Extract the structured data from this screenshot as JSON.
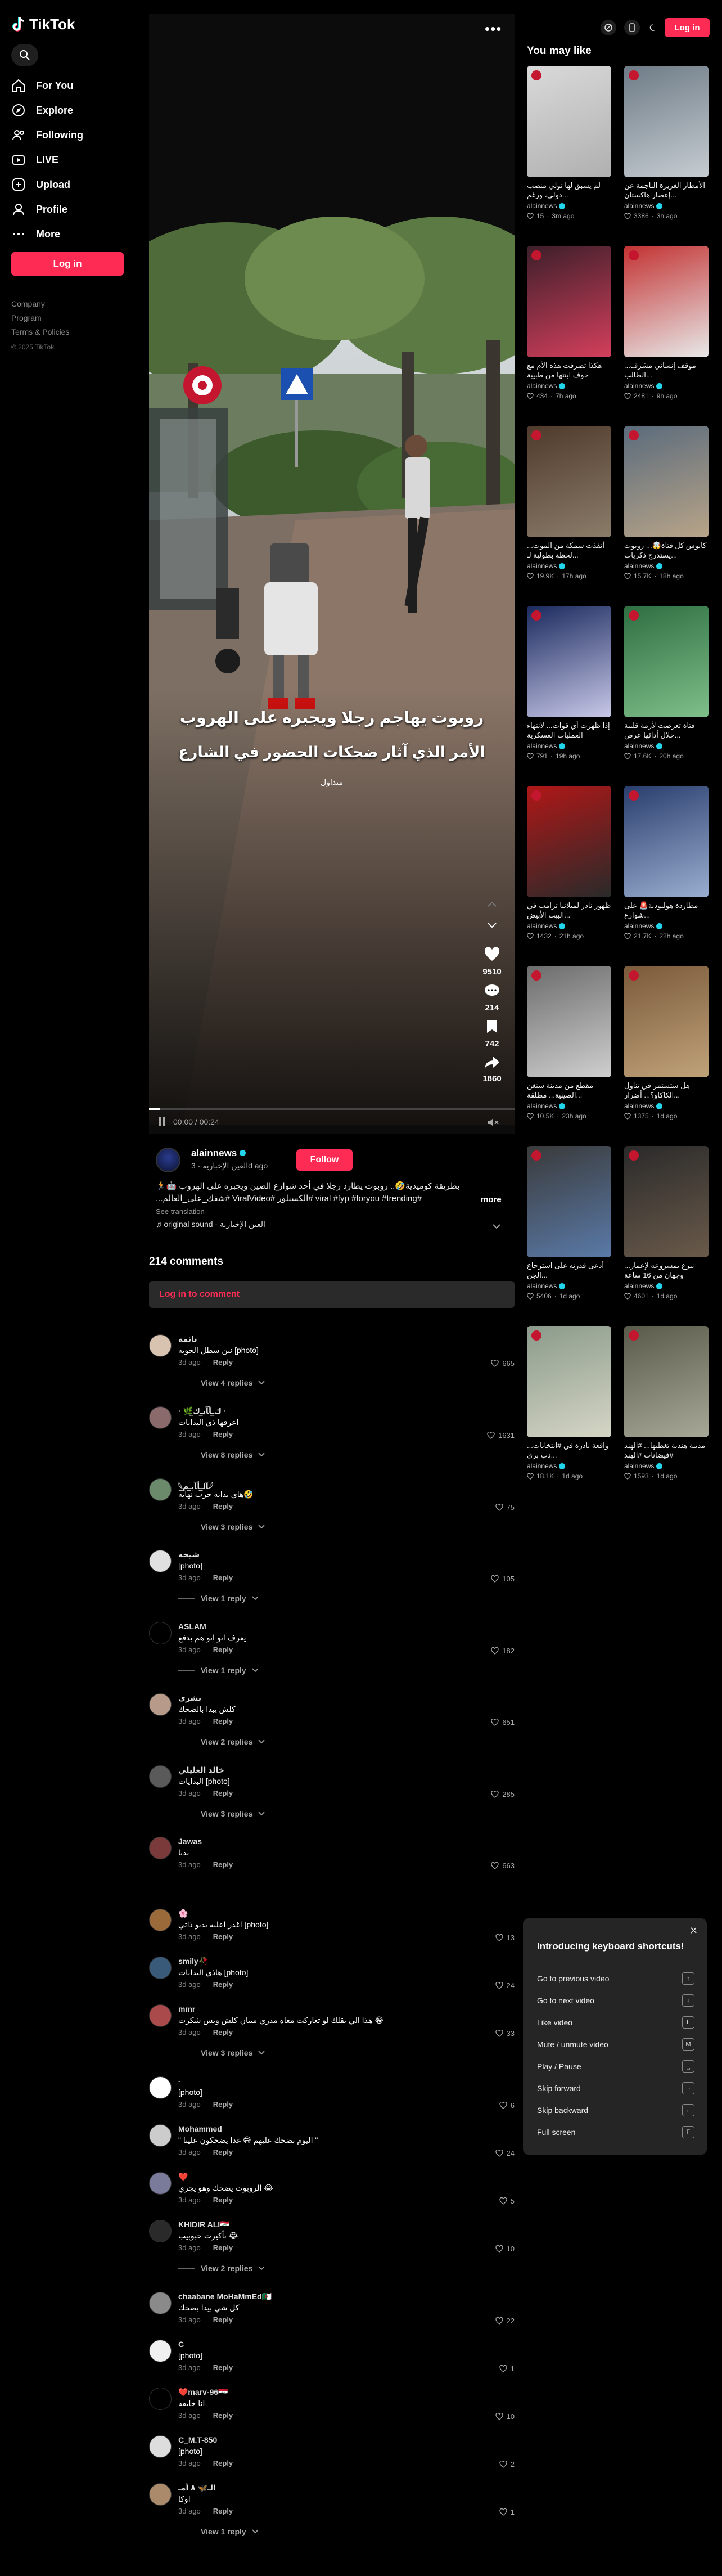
{
  "sidebar": {
    "logo": "TikTok",
    "nav": [
      {
        "label": "For You",
        "icon": "home-icon"
      },
      {
        "label": "Explore",
        "icon": "compass-icon"
      },
      {
        "label": "Following",
        "icon": "following-icon"
      },
      {
        "label": "LIVE",
        "icon": "live-icon"
      },
      {
        "label": "Upload",
        "icon": "upload-icon"
      },
      {
        "label": "Profile",
        "icon": "profile-icon"
      },
      {
        "label": "More",
        "icon": "more-icon"
      }
    ],
    "login_label": "Log in",
    "footer": [
      "Company",
      "Program",
      "Terms & Policies"
    ],
    "copyright": "© 2025 TikTok"
  },
  "topbar": {
    "login_label": "Log in"
  },
  "video": {
    "overlay_line1": "روبوت يهاجم رجلا ويجبره على الهروب",
    "overlay_line2": "الأمر الذي آثار ضحكات الحضور  في الشارع",
    "overlay_tag": "متداول",
    "likes": "9510",
    "comments": "214",
    "saves": "742",
    "shares": "1860",
    "time": "00:00 / 00:24",
    "progress": 0.03
  },
  "author": {
    "name": "alainnews",
    "sub": "العين الإخبارية · 3d ago",
    "follow_label": "Follow",
    "caption": "بطريقة كوميدية🤣.. روبوت يطارد رجلا في أحد شوارع الصين ويجبره على الهروب 🤖🏃 #viral #fyp #foryou #trending #الكسبلور #ViralVideo #شفك_على_العالم...",
    "more_label": "more",
    "see_translation": "See translation",
    "music": "original sound - العين الإخبارية"
  },
  "comments_header": "214 comments",
  "login_comment": "Log in to comment",
  "comments": [
    {
      "name": "نائمه",
      "text": "نين سطل الجوبه [photo]",
      "date": "3d ago",
      "likes": "665",
      "replies": "View 4 replies"
    },
    {
      "name": "· 🌿ﻙ̲ـﺄﺂﻳ̲ـﻙ̲ ·",
      "text": "اعرفها ذي البدايات",
      "date": "3d ago",
      "likes": "1631",
      "replies": "View 8 replies"
    },
    {
      "name": "𓆩ﺂﻟ̲ـﺄﺂﻳ̲ـﻡ̲𓆪",
      "text": "هاي بدايه حرب نهايه🤣",
      "date": "3d ago",
      "likes": "75",
      "replies": "View 3 replies"
    },
    {
      "name": "شيخه",
      "text": "[photo]",
      "date": "3d ago",
      "likes": "105",
      "replies": "View 1 reply"
    },
    {
      "name": "ASLAM",
      "text": "يعرف انو انو هم يدفع",
      "date": "3d ago",
      "likes": "182",
      "replies": "View 1 reply"
    },
    {
      "name": "بشرى",
      "text": "كلش يبدا بالضحك",
      "date": "3d ago",
      "likes": "651",
      "replies": "View 2 replies"
    },
    {
      "name": "خالد العليلي",
      "text": "البدايات [photo]",
      "date": "3d ago",
      "likes": "285",
      "replies": "View 3 replies"
    },
    {
      "name": "Jawas",
      "text": "بديا",
      "date": "3d ago",
      "likes": "663",
      "replies": ""
    },
    {
      "name": "🌸",
      "text": "اغدر اعليه بديو ذاتي [photo]",
      "date": "3d ago",
      "likes": "13",
      "replies": ""
    },
    {
      "name": "smily🥀",
      "text": "هاذي البدايات [photo]",
      "date": "3d ago",
      "likes": "24",
      "replies": ""
    },
    {
      "name": "mmr",
      "text": "هذا الي يقلك لو تعاركت معاه مدري ميبان كلش ويس شكرت 😂",
      "date": "3d ago",
      "likes": "33",
      "replies": "View 3 replies"
    },
    {
      "name": "-",
      "text": "[photo]",
      "date": "3d ago",
      "likes": "6",
      "replies": ""
    },
    {
      "name": "Mohammed",
      "text": "\" اليوم نضحك عليهم 😅 غدا يضحكون علينا \"",
      "date": "3d ago",
      "likes": "24",
      "replies": ""
    },
    {
      "name": "❤️",
      "text": "الروبوت يضحك وهو يجري 😂",
      "date": "3d ago",
      "likes": "5",
      "replies": ""
    },
    {
      "name": "KHIDIR ALI🇮🇶",
      "text": "تأكيرت حبوبيب 😂",
      "date": "3d ago",
      "likes": "10",
      "replies": "View 2 replies"
    },
    {
      "name": "chaabane MoHaMmEd🇩🇿",
      "text": "كل شي بيدا بضحك",
      "date": "3d ago",
      "likes": "22",
      "replies": ""
    },
    {
      "name": "C",
      "text": "[photo]",
      "date": "3d ago",
      "likes": "1",
      "replies": ""
    },
    {
      "name": "❤️marv-96🇮🇶",
      "text": "انا خايفه",
      "date": "3d ago",
      "likes": "10",
      "replies": ""
    },
    {
      "name": "C_M.T-850",
      "text": "[photo]",
      "date": "3d ago",
      "likes": "2",
      "replies": ""
    },
    {
      "name": "الـ🦋 ٨ أمـ",
      "text": "اوكا",
      "date": "3d ago",
      "likes": "1",
      "replies": "View 1 reply"
    }
  ],
  "reply_label": "Reply",
  "you_may_like": "You may like",
  "cards": [
    {
      "title": "لم يسبق لها تولي منصب دولي، ورغم...",
      "author": "alainnews",
      "likes": "15",
      "time": "3m ago",
      "colors": [
        "#d9d9d9",
        "#b0b0b0"
      ]
    },
    {
      "title": "الأمطار الغزيرة الناجمة عن إعصار هاكستان...",
      "author": "alainnews",
      "likes": "3386",
      "time": "3h ago",
      "colors": [
        "#6e7b86",
        "#c6cdd2"
      ]
    },
    {
      "title": "هكذا تصرفت هذه الأم مع خوف ابنتها من طبيبة",
      "author": "alainnews",
      "likes": "434",
      "time": "7h ago",
      "colors": [
        "#3d1f2a",
        "#d43f5c"
      ]
    },
    {
      "title": "موقف إنساني مشرف... الطالب...",
      "author": "alainnews",
      "likes": "2481",
      "time": "9h ago",
      "colors": [
        "#c33232",
        "#e8e8e8"
      ]
    },
    {
      "title": "أنقذت سمكة من الموت... لحظة بطولية لـ...",
      "author": "alainnews",
      "likes": "19.9K",
      "time": "17h ago",
      "colors": [
        "#4f3a2b",
        "#8b7c6a"
      ]
    },
    {
      "title": "كابوس كل فتاة🤯... روبوت يستدرج ذكريات...",
      "author": "alainnews",
      "likes": "15.7K",
      "time": "18h ago",
      "colors": [
        "#5a6b7c",
        "#b8a488"
      ]
    },
    {
      "title": "إذا ظهرت أي قوات... لانتهاء العمليات العسكرية",
      "author": "alainnews",
      "likes": "791",
      "time": "19h ago",
      "colors": [
        "#1a2a5e",
        "#c8c8e8"
      ]
    },
    {
      "title": "فتاة تعرضت لأزمة قلبية خلال أدائها عرض...",
      "author": "alainnews",
      "likes": "17.6K",
      "time": "20h ago",
      "colors": [
        "#2e6f42",
        "#7fbf8a"
      ]
    },
    {
      "title": "ظهور نادر لميلانيا ترامب في البيت الأبيض...",
      "author": "alainnews",
      "likes": "1432",
      "time": "21h ago",
      "colors": [
        "#b01717",
        "#2a2a2a"
      ]
    },
    {
      "title": "مطاردة هوليودية🚨 على شوارع...",
      "author": "alainnews",
      "likes": "21.7K",
      "time": "22h ago",
      "colors": [
        "#2a3e6e",
        "#9aaed0"
      ]
    },
    {
      "title": "مقطع من مدينة شنغن الصينية... مطلقة...",
      "author": "alainnews",
      "likes": "10.5K",
      "time": "23h ago",
      "colors": [
        "#6c6c6c",
        "#cfcfcf"
      ]
    },
    {
      "title": "هل ستستمر في تناول الكاكاو؟... أضرار...",
      "author": "alainnews",
      "likes": "1375",
      "time": "1d ago",
      "colors": [
        "#7a5a3a",
        "#c0a27a"
      ]
    },
    {
      "title": "أدعى قدرته على استرجاع الجن...",
      "author": "alainnews",
      "likes": "5406",
      "time": "1d ago",
      "colors": [
        "#3a3a3a",
        "#5a7aa8"
      ]
    },
    {
      "title": "نبرع بمشروعه لإعمار... وجهان من 16 ساعة",
      "author": "alainnews",
      "likes": "4601",
      "time": "1d ago",
      "colors": [
        "#2a2a2a",
        "#6a5a4a"
      ]
    },
    {
      "title": "واقعة نادرة في #انتخابات... دب بري...",
      "author": "alainnews",
      "likes": "18.1K",
      "time": "1d ago",
      "colors": [
        "#8a9a8a",
        "#d6d6c6"
      ]
    },
    {
      "title": "مدينة هندية تغطيها... #الهند #فيضانات #الهند",
      "author": "alainnews",
      "likes": "1593",
      "time": "1d ago",
      "colors": [
        "#5a5a4a",
        "#a8a898"
      ]
    }
  ],
  "shortcuts": {
    "title": "Introducing keyboard shortcuts!",
    "rows": [
      {
        "label": "Go to previous video",
        "key": "↑"
      },
      {
        "label": "Go to next video",
        "key": "↓"
      },
      {
        "label": "Like video",
        "key": "L"
      },
      {
        "label": "Mute / unmute video",
        "key": "M"
      },
      {
        "label": "Play / Pause",
        "key": "␣"
      },
      {
        "label": "Skip forward",
        "key": "→"
      },
      {
        "label": "Skip backward",
        "key": "←"
      },
      {
        "label": "Full screen",
        "key": "F"
      }
    ]
  }
}
